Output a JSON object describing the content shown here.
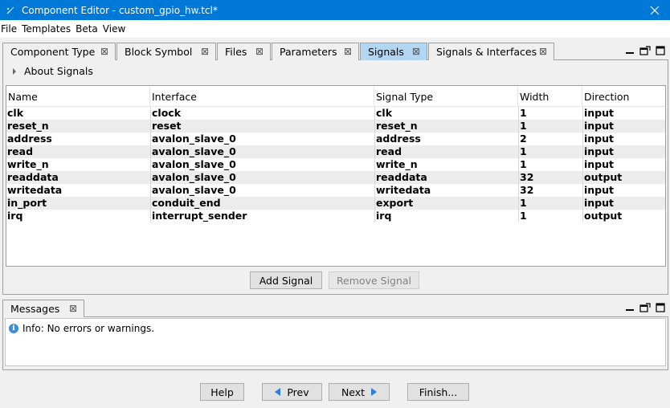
{
  "window": {
    "title": "Component Editor - custom_gpio_hw.tcl*"
  },
  "menu": [
    "File",
    "Templates",
    "Beta",
    "View"
  ],
  "tabs": [
    {
      "label": "Component Type"
    },
    {
      "label": "Block Symbol"
    },
    {
      "label": "Files"
    },
    {
      "label": "Parameters"
    },
    {
      "label": "Signals"
    },
    {
      "label": "Signals & Interfaces"
    }
  ],
  "active_tab": "Signals",
  "about_label": "About Signals",
  "table": {
    "headers": [
      "Name",
      "Interface",
      "Signal Type",
      "Width",
      "Direction"
    ],
    "rows": [
      [
        "clk",
        "clock",
        "clk",
        "1",
        "input"
      ],
      [
        "reset_n",
        "reset",
        "reset_n",
        "1",
        "input"
      ],
      [
        "address",
        "avalon_slave_0",
        "address",
        "2",
        "input"
      ],
      [
        "read",
        "avalon_slave_0",
        "read",
        "1",
        "input"
      ],
      [
        "write_n",
        "avalon_slave_0",
        "write_n",
        "1",
        "input"
      ],
      [
        "readdata",
        "avalon_slave_0",
        "readdata",
        "32",
        "output"
      ],
      [
        "writedata",
        "avalon_slave_0",
        "writedata",
        "32",
        "input"
      ],
      [
        "in_port",
        "conduit_end",
        "export",
        "1",
        "input"
      ],
      [
        "irq",
        "interrupt_sender",
        "irq",
        "1",
        "output"
      ]
    ]
  },
  "buttons": {
    "add_signal": "Add Signal",
    "remove_signal": "Remove Signal",
    "help": "Help",
    "prev": "Prev",
    "next": "Next",
    "finish": "Finish..."
  },
  "messages": {
    "tab_label": "Messages",
    "lines": [
      "Info: No errors or warnings."
    ]
  },
  "colors": {
    "titlebar": "#0078d7",
    "active_tab": "#b3d7f3",
    "info": "#3c8fd4"
  }
}
